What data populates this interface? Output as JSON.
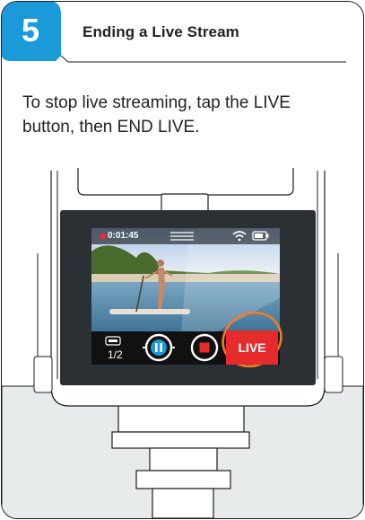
{
  "step": {
    "number": "5",
    "title": "Ending a Live Stream"
  },
  "instruction": "To stop live streaming, tap the LIVE button, then END LIVE.",
  "screen": {
    "timer": "0:01:45",
    "page_indicator": "1/2",
    "live_label": "LIVE",
    "icons": [
      "record-dot-icon",
      "menu-lines-icon",
      "wifi-icon",
      "battery-icon",
      "mode-icon",
      "pause-icon",
      "stop-icon"
    ]
  },
  "colors": {
    "brand_blue": "#1a9ad9",
    "live_red": "#e52b2b",
    "highlight_orange": "#ef7d22",
    "housing_dark": "#2b3034"
  }
}
